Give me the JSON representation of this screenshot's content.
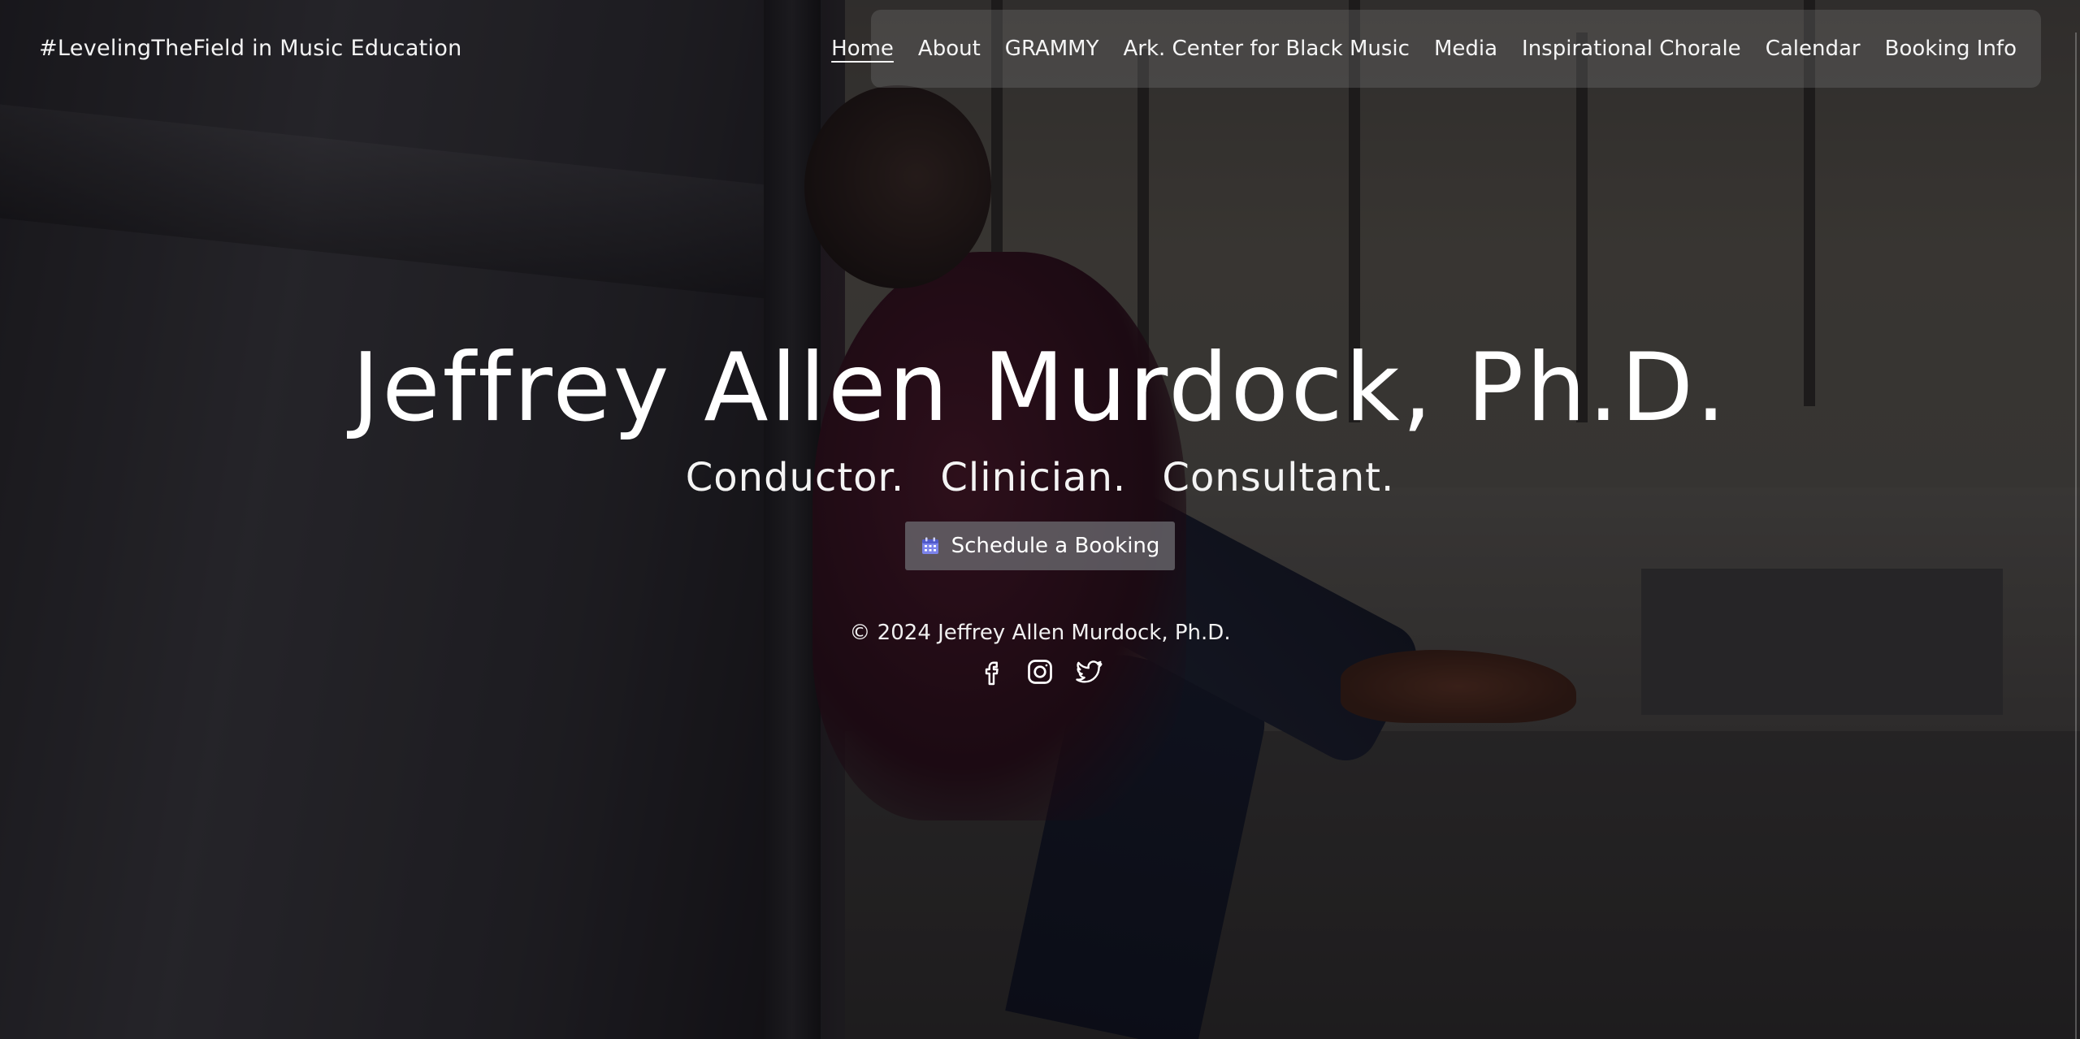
{
  "header": {
    "site_title": "#LevelingTheField in Music Education"
  },
  "nav": {
    "items": [
      {
        "label": "Home",
        "active": true
      },
      {
        "label": "About"
      },
      {
        "label": "GRAMMY"
      },
      {
        "label": "Ark. Center for Black Music"
      },
      {
        "label": "Media"
      },
      {
        "label": "Inspirational Chorale"
      },
      {
        "label": "Calendar"
      },
      {
        "label": "Booking Info"
      }
    ]
  },
  "hero": {
    "name": "Jeffrey Allen Murdock, Ph.D.",
    "roles": [
      "Conductor.",
      "Clinician.",
      "Consultant."
    ],
    "cta_label": "Schedule a Booking",
    "cta_icon": "calendar-icon"
  },
  "footer": {
    "copyright": "© 2024 Jeffrey Allen Murdock, Ph.D.",
    "social_icons": [
      "facebook-icon",
      "instagram-icon",
      "twitter-icon"
    ]
  },
  "colors": {
    "text": "#ffffff",
    "nav_bg": "#787878",
    "button_bg": "#6e6e73",
    "calendar_icon": "#7b83eb"
  }
}
